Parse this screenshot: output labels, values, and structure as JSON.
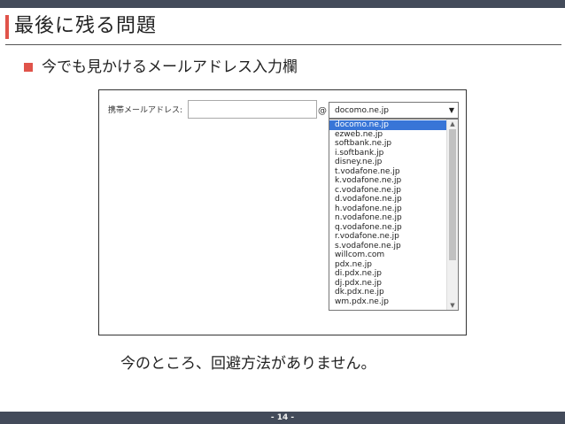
{
  "slide": {
    "title": "最後に残る問題",
    "bullet": "今でも見かけるメールアドレス入力欄",
    "message": "今のところ、回避方法がありません。",
    "page_number": "- 14 -"
  },
  "form": {
    "label": "携帯メールアドレス:",
    "at": "@",
    "selected": "docomo.ne.jp",
    "options": [
      "docomo.ne.jp",
      "ezweb.ne.jp",
      "softbank.ne.jp",
      "i.softbank.jp",
      "disney.ne.jp",
      "t.vodafone.ne.jp",
      "k.vodafone.ne.jp",
      "c.vodafone.ne.jp",
      "d.vodafone.ne.jp",
      "h.vodafone.ne.jp",
      "n.vodafone.ne.jp",
      "q.vodafone.ne.jp",
      "r.vodafone.ne.jp",
      "s.vodafone.ne.jp",
      "willcom.com",
      "pdx.ne.jp",
      "di.pdx.ne.jp",
      "dj.pdx.ne.jp",
      "dk.pdx.ne.jp",
      "wm.pdx.ne.jp"
    ],
    "highlighted_index": 0,
    "caret_icon": "caret-down-icon"
  },
  "colors": {
    "bar": "#434b5a",
    "accent": "#e0534a",
    "highlight": "#3875d7"
  }
}
